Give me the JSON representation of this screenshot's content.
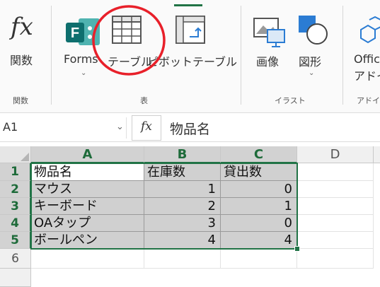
{
  "ribbon": {
    "function_label": "関数",
    "function_group": "関数",
    "forms_label": "Forms",
    "table_label": "テーブル",
    "pivot_label": "ピボットテーブル",
    "tables_group": "表",
    "image_label": "画像",
    "shape_label": "図形",
    "illust_group": "イラスト",
    "office_label_1": "Offic",
    "office_label_2": "アドイ",
    "addin_group": "アドイ"
  },
  "formula_bar": {
    "name_box": "A1",
    "fx": "fx",
    "content": "物品名"
  },
  "columns": [
    "A",
    "B",
    "C",
    "D"
  ],
  "rows": [
    "1",
    "2",
    "3",
    "4",
    "5",
    "6"
  ],
  "cells": {
    "r1": [
      "物品名",
      "在庫数",
      "貸出数"
    ],
    "r2": [
      "マウス",
      "1",
      "0"
    ],
    "r3": [
      "キーボード",
      "2",
      "1"
    ],
    "r4": [
      "OAタップ",
      "3",
      "0"
    ],
    "r5": [
      "ボールペン",
      "4",
      "4"
    ]
  },
  "colors": {
    "accent_green": "#217346",
    "annotation_red": "#e8202a"
  }
}
